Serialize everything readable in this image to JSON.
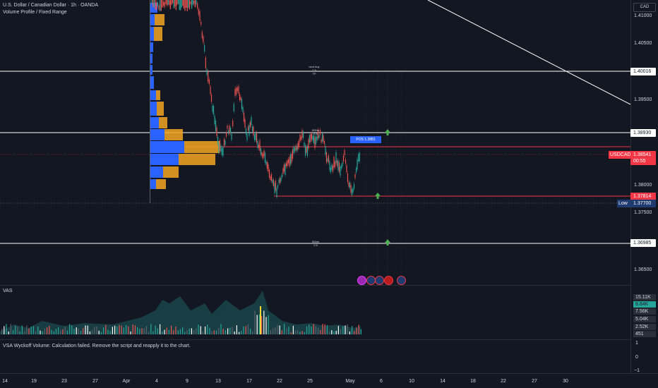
{
  "header": {
    "symbol_title": "U.S. Dollar / Canadian Dollar · 1h · OANDA",
    "indicator": "Volume Profile / Fixed Range"
  },
  "currency": "CAD",
  "price_axis": {
    "ticks": [
      "1.41000",
      "1.40500",
      "1.39500",
      "1.38000",
      "1.37500",
      "1.36500"
    ]
  },
  "price_tags": {
    "level_1": "1.40016",
    "level_2": "1.38930",
    "symbol": "USDCAD",
    "current": "1.38541",
    "countdown": "00:55",
    "level_3": "1.37814",
    "low_label": "Low",
    "low_value": "1.37700",
    "level_4": "1.36985"
  },
  "annotations": {
    "next_buy": "next buy",
    "next_buy_ratio": "1.5",
    "next_buy_tp": "TP",
    "upper_tag": "900m",
    "upper_ratio": "2.5",
    "lower_tag": "900m",
    "lower_ratio": "2.5",
    "position_label": "POS 1.3881",
    "position_label_sub": "·"
  },
  "date_axis": [
    "14",
    "19",
    "23",
    "27",
    "Apr",
    "4",
    "9",
    "13",
    "17",
    "22",
    "25",
    "May",
    "6",
    "10",
    "14",
    "18",
    "22",
    "27",
    "30"
  ],
  "volume_panel": {
    "title": "VAS",
    "values": [
      "15.11K",
      "8.84K",
      "7.56K",
      "5.04K",
      "2.52K",
      "451"
    ]
  },
  "error_panel": {
    "message": "VSA Wyckoff Volume: Calculation failed. Remove the script and reapply it to the chart.",
    "ticks": [
      "1",
      "0",
      "−1"
    ]
  },
  "colors": {
    "background": "#131722",
    "bull": "#26a69a",
    "bear": "#ef5350",
    "profile_blue": "#2962ff",
    "profile_orange": "#f5a623",
    "red_line": "#f23645"
  }
}
